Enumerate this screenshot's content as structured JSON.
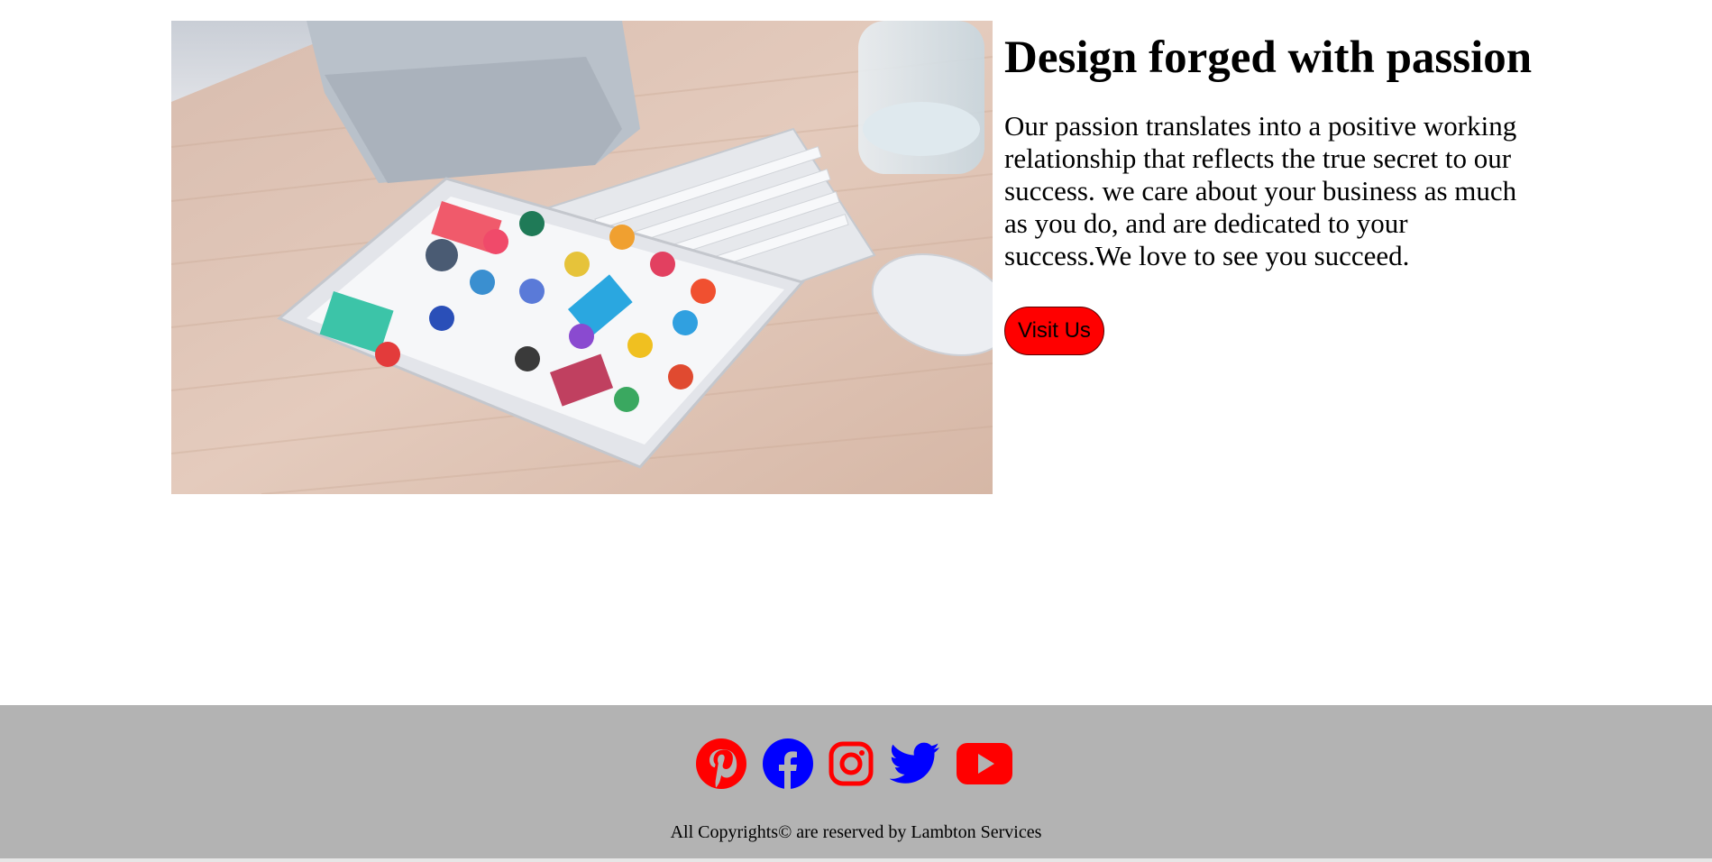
{
  "hero": {
    "image_alt": "Tablet showing app store on desk with keyboard and mouse",
    "title": "Design forged with passion",
    "body": "Our passion translates into a positive working relationship that reflects the true secret to our success. we care about your business as much as you do, and are dedicated to your success.We love to see you succeed.",
    "button_label": "Visit Us"
  },
  "footer": {
    "socials": [
      {
        "name": "pinterest-icon",
        "color": "#ff0000"
      },
      {
        "name": "facebook-icon",
        "color": "#0000ff"
      },
      {
        "name": "instagram-icon",
        "color": "#ff0000"
      },
      {
        "name": "twitter-icon",
        "color": "#0000ff"
      },
      {
        "name": "youtube-icon",
        "color": "#ff0000"
      }
    ],
    "copyright": "All Copyrights© are reserved by Lambton Services"
  },
  "colors": {
    "button_bg": "#ff0000",
    "footer_bg": "#b3b3b3"
  }
}
